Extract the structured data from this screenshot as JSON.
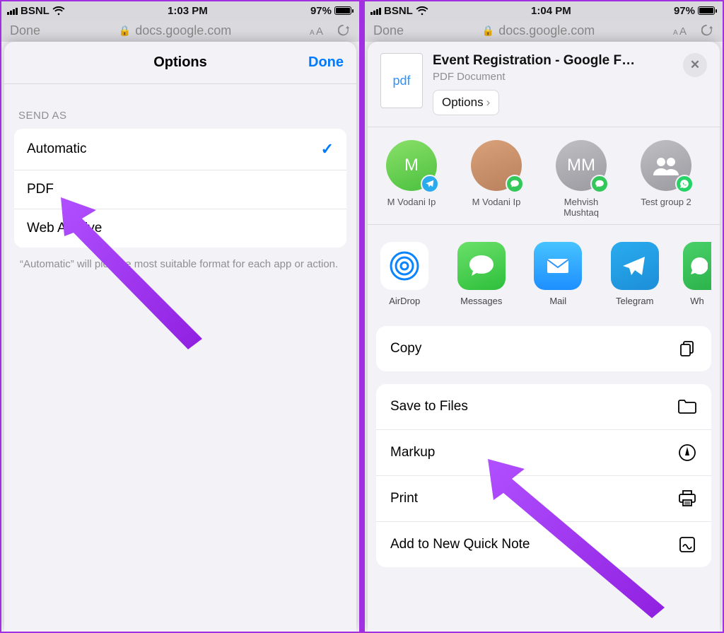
{
  "left": {
    "status": {
      "carrier": "BSNL",
      "time": "1:03 PM",
      "battery": "97%"
    },
    "safari": {
      "done": "Done",
      "url": "docs.google.com"
    },
    "sheet": {
      "title": "Options",
      "done": "Done",
      "sectionLabel": "SEND AS",
      "options": [
        {
          "label": "Automatic",
          "checked": true
        },
        {
          "label": "PDF",
          "checked": false
        },
        {
          "label": "Web Archive",
          "checked": false
        }
      ],
      "footnote": "“Automatic” will pick the most suitable format for each app or action."
    }
  },
  "right": {
    "status": {
      "carrier": "BSNL",
      "time": "1:04 PM",
      "battery": "97%"
    },
    "safari": {
      "done": "Done",
      "url": "docs.google.com"
    },
    "share": {
      "thumbLabel": "pdf",
      "fileTitle": "Event Registration - Google F…",
      "fileSubtitle": "PDF Document",
      "optionsLabel": "Options",
      "contacts": [
        {
          "initial": "M",
          "name": "M Vodani Ip",
          "badge": "telegram",
          "avatar": "green"
        },
        {
          "initial": "",
          "name": "M Vodani Ip",
          "badge": "messages",
          "avatar": "photo"
        },
        {
          "initial": "MM",
          "name": "Mehvish Mushtaq",
          "badge": "messages",
          "avatar": "grey"
        },
        {
          "initial": "",
          "name": "Test group 2",
          "badge": "whatsapp",
          "avatar": "grey",
          "groupIcon": true
        }
      ],
      "apps": [
        {
          "name": "AirDrop",
          "type": "airdrop"
        },
        {
          "name": "Messages",
          "type": "messages"
        },
        {
          "name": "Mail",
          "type": "mail"
        },
        {
          "name": "Telegram",
          "type": "telegram"
        },
        {
          "name": "Wh",
          "type": "whatsapp"
        }
      ],
      "actions1": [
        {
          "label": "Copy",
          "icon": "copy"
        }
      ],
      "actions2": [
        {
          "label": "Save to Files",
          "icon": "folder"
        },
        {
          "label": "Markup",
          "icon": "markup"
        },
        {
          "label": "Print",
          "icon": "print"
        },
        {
          "label": "Add to New Quick Note",
          "icon": "quicknote"
        }
      ]
    }
  },
  "icons": {
    "chevron": "›",
    "close": "✕",
    "check": "✓"
  }
}
